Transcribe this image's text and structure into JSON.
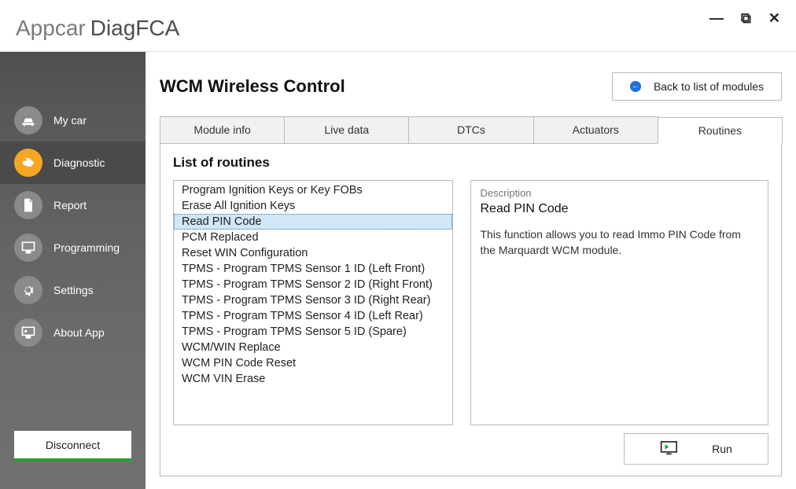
{
  "app": {
    "title1": "Appcar",
    "title2": "DiagFCA"
  },
  "sidebar": {
    "items": [
      {
        "label": "My car"
      },
      {
        "label": "Diagnostic"
      },
      {
        "label": "Report"
      },
      {
        "label": "Programming"
      },
      {
        "label": "Settings"
      },
      {
        "label": "About App"
      }
    ],
    "disconnect": "Disconnect"
  },
  "page": {
    "title": "WCM Wireless Control",
    "back_label": "Back to list of modules"
  },
  "tabs": {
    "module_info": "Module info",
    "live_data": "Live data",
    "dtcs": "DTCs",
    "actuators": "Actuators",
    "routines": "Routines"
  },
  "routines": {
    "section_title": "List of routines",
    "items": [
      "Program Ignition Keys or Key FOBs",
      "Erase All Ignition Keys",
      "Read PIN Code",
      "PCM Replaced",
      "Reset WIN Configuration",
      "TPMS - Program TPMS Sensor 1 ID (Left Front)",
      "TPMS - Program TPMS Sensor 2 ID (Right Front)",
      "TPMS - Program TPMS Sensor 3 ID (Right Rear)",
      "TPMS - Program TPMS Sensor 4 ID (Left Rear)",
      "TPMS - Program TPMS Sensor 5 ID (Spare)",
      "WCM/WIN Replace",
      "WCM PIN Code Reset",
      "WCM VIN Erase"
    ],
    "selected_index": 2,
    "desc_label": "Description",
    "desc_title": "Read PIN Code",
    "desc_text": "This function allows you to read Immo PIN Code from the Marquardt WCM module.",
    "run_label": "Run"
  }
}
